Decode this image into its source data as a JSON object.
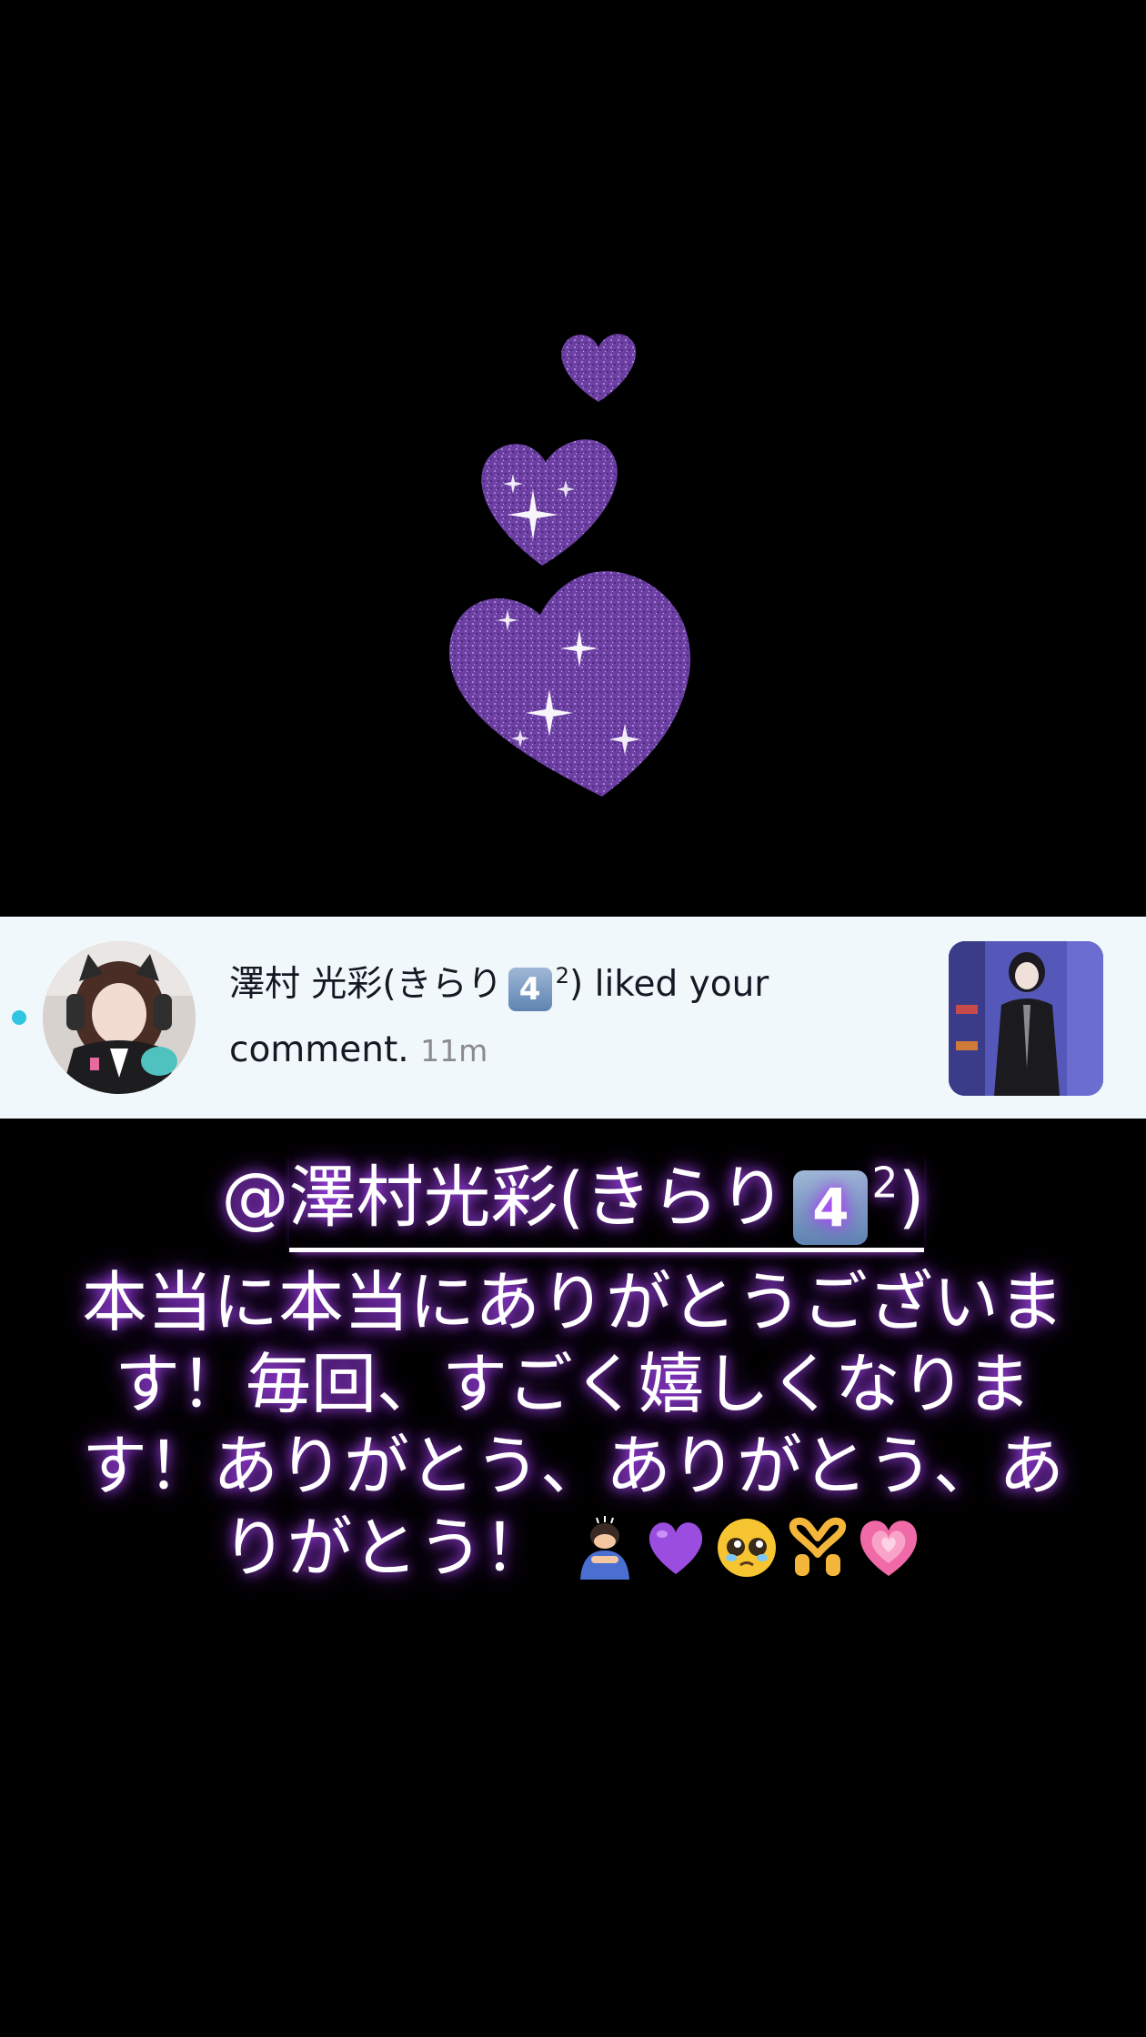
{
  "notification": {
    "username": "澤村 光彩(きらり",
    "username_badge": "4",
    "username_superscript": "2",
    "username_close": ")",
    "action": " liked your comment.",
    "time": "11m"
  },
  "reply": {
    "mention_prefix": "@",
    "mention_name": "澤村光彩(きらり",
    "mention_badge": "4",
    "mention_superscript": "2",
    "mention_close": ")",
    "body": "本当に本当にありがとうございます！毎回、すごく嬉しくなります！ありがとう、ありがとう、ありがとう！",
    "emojis": [
      "bowing-person-icon",
      "purple-heart-icon",
      "pleading-face-icon",
      "heart-hands-icon",
      "growing-heart-icon"
    ]
  },
  "colors": {
    "background": "#000000",
    "banner": "#f1f8fb",
    "unread_dot": "#2ec6e0",
    "glitter_purple": "#7a4bb0",
    "glow": "#b44cff"
  }
}
